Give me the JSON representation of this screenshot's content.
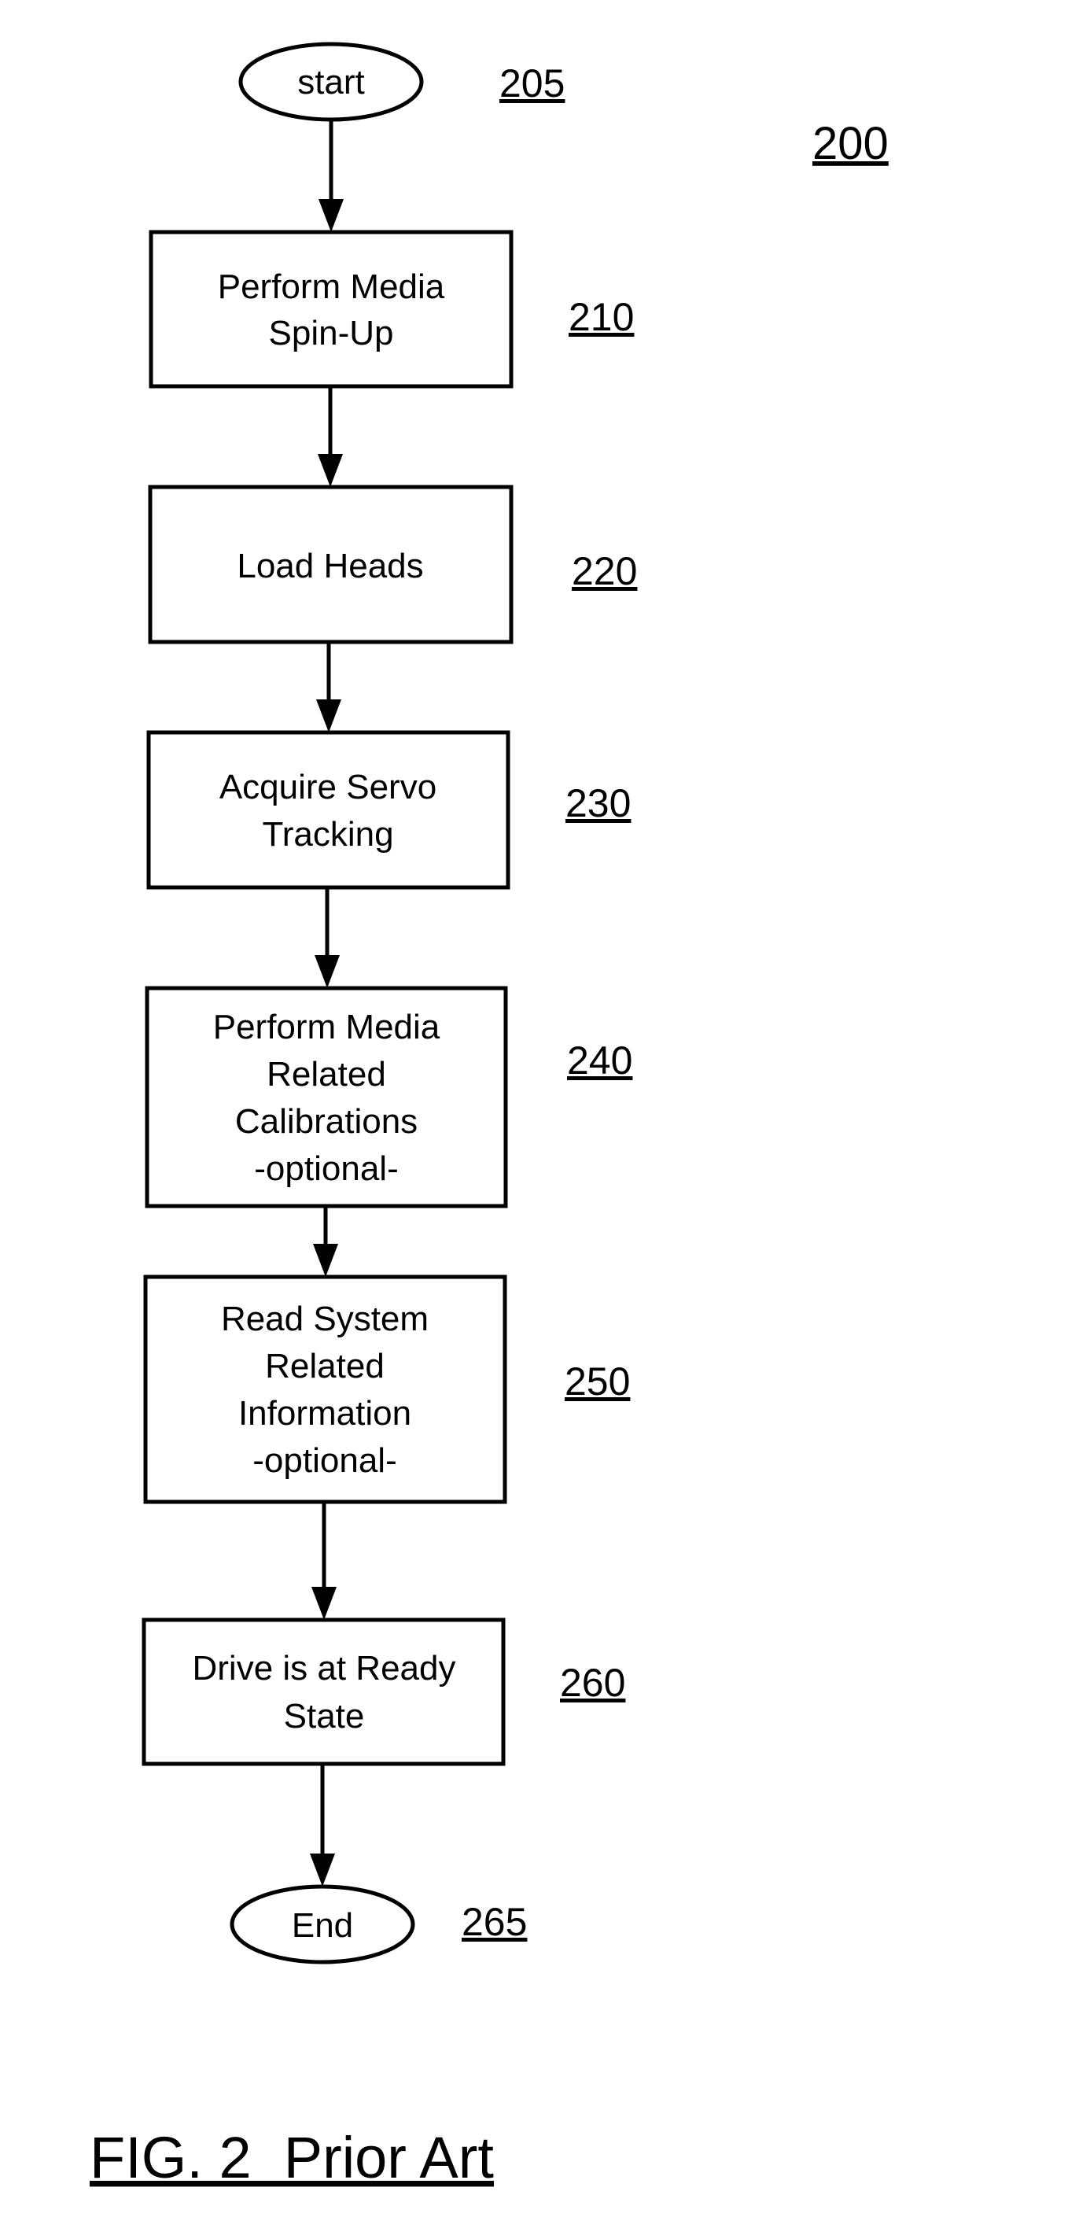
{
  "figure": {
    "ref": "200",
    "caption": "FIG. 2  Prior Art"
  },
  "start": {
    "label": "start",
    "ref": "205"
  },
  "steps": [
    {
      "ref": "210",
      "lines": [
        "Perform Media",
        "Spin-Up"
      ]
    },
    {
      "ref": "220",
      "lines": [
        "Load Heads"
      ]
    },
    {
      "ref": "230",
      "lines": [
        "Acquire Servo",
        "Tracking"
      ]
    },
    {
      "ref": "240",
      "lines": [
        "Perform Media",
        "Related",
        "Calibrations",
        "-optional-"
      ]
    },
    {
      "ref": "250",
      "lines": [
        "Read System",
        "Related",
        "Information",
        "-optional-"
      ]
    },
    {
      "ref": "260",
      "lines": [
        "Drive is at Ready",
        "State"
      ]
    }
  ],
  "end": {
    "label": "End",
    "ref": "265"
  },
  "colors": {
    "ink": "#000000",
    "paper": "#ffffff"
  }
}
